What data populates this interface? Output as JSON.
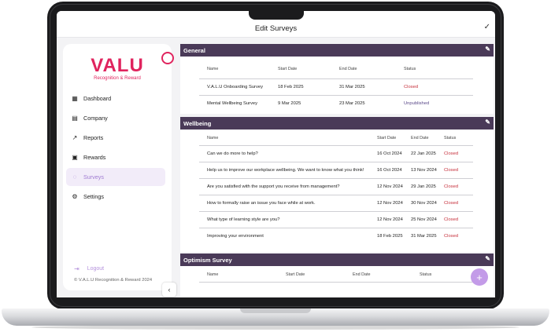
{
  "header": {
    "title": "Edit Surveys",
    "confirm_icon": "check-icon"
  },
  "brand": {
    "logo_word": "VALU",
    "logo_tagline": "Recognition & Reward",
    "color": "#e0245e"
  },
  "nav": {
    "items": [
      {
        "label": "Dashboard",
        "icon": "dashboard-icon"
      },
      {
        "label": "Company",
        "icon": "building-icon"
      },
      {
        "label": "Reports",
        "icon": "trend-icon"
      },
      {
        "label": "Rewards",
        "icon": "gift-icon"
      },
      {
        "label": "Surveys",
        "icon": "survey-icon",
        "active": true
      },
      {
        "label": "Settings",
        "icon": "gear-icon"
      }
    ],
    "logout": "Logout",
    "copyright": "© V.A.L.U Recognition & Reward 2024"
  },
  "sections": [
    {
      "title": "General",
      "columns": [
        "Name",
        "Start Date",
        "End Date",
        "Status"
      ],
      "rows": [
        {
          "name": "V.A.L.U Onboarding Survey",
          "start": "18 Feb 2025",
          "end": "31 Mar 2025",
          "status": "Closed"
        },
        {
          "name": "Mental Wellbeing Survey",
          "start": "9 Mar 2025",
          "end": "23 Mar 2025",
          "status": "Unpublished"
        }
      ]
    },
    {
      "title": "Wellbeing",
      "columns": [
        "Name",
        "Start Date",
        "End Date",
        "Status"
      ],
      "rows": [
        {
          "name": "Can we do more to help?",
          "start": "16 Oct 2024",
          "end": "22 Jan 2025",
          "status": "Closed"
        },
        {
          "name": "Help us to improve our workplace wellbeing. We want to know what you think!",
          "start": "16 Oct 2024",
          "end": "13 Nov 2024",
          "status": "Closed"
        },
        {
          "name": "Are you satisfied with the support you receive from management?",
          "start": "12 Nov 2024",
          "end": "29 Jan 2025",
          "status": "Closed"
        },
        {
          "name": "How to formally raise an issue you face while at work.",
          "start": "12 Nov 2024",
          "end": "30 Nov 2024",
          "status": "Closed"
        },
        {
          "name": "What type of learning style are you?",
          "start": "12 Nov 2024",
          "end": "25 Nov 2024",
          "status": "Closed"
        },
        {
          "name": "Improving your environment",
          "start": "18 Feb 2025",
          "end": "31 Mar 2025",
          "status": "Closed"
        }
      ]
    },
    {
      "title": "Optimism Survey",
      "columns": [
        "Name",
        "Start Date",
        "End Date",
        "Status"
      ],
      "rows": []
    }
  ],
  "fab_label": "+"
}
